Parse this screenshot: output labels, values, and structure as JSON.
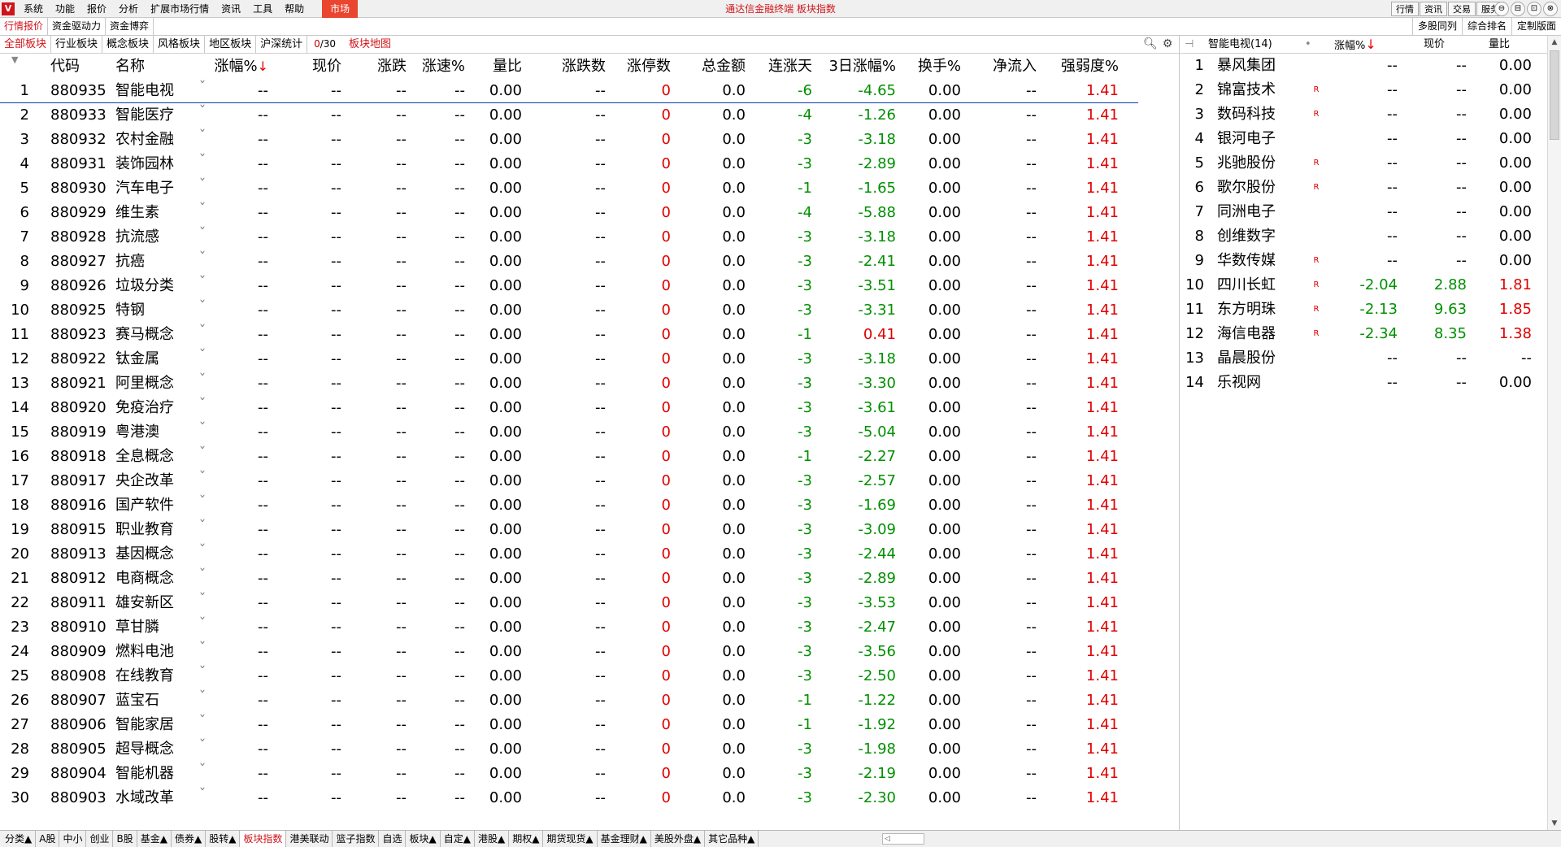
{
  "app": {
    "logo_glyph": "V",
    "title": "通达信金融终端  板块指数",
    "menu": [
      "系统",
      "功能",
      "报价",
      "分析",
      "扩展市场行情",
      "资讯",
      "工具",
      "帮助"
    ],
    "market_button": "市场",
    "right_buttons": [
      "行情",
      "资讯",
      "交易",
      "服务"
    ],
    "window_controls": [
      "⊖",
      "⊟",
      "⊡",
      "⊗"
    ]
  },
  "row2": {
    "tabs": [
      "行情报价",
      "资金驱动力",
      "资金博弈"
    ],
    "right_tabs": [
      "多股同列",
      "综合排名",
      "定制版面"
    ]
  },
  "categories": {
    "tabs": [
      "全部板块",
      "行业板块",
      "概念板块",
      "风格板块",
      "地区板块",
      "沪深统计"
    ],
    "active": 0,
    "counter_current": "0",
    "counter_total": "/30",
    "map_link": "板块地图",
    "icons": [
      "search-icon",
      "gear-icon"
    ]
  },
  "table": {
    "sort_indicator": "▼",
    "headers": {
      "code": "代码",
      "name": "名称",
      "chg": "涨幅%",
      "price": "现价",
      "updn": "涨跌",
      "speed": "涨速%",
      "vr": "量比",
      "count": "涨跌数",
      "lim": "涨停数",
      "amt": "总金额",
      "cont": "连涨天",
      "d3": "3日涨幅%",
      "turn": "换手%",
      "flow": "净流入",
      "str": "强弱度%"
    },
    "sort_arrow": "↓",
    "rows": [
      {
        "idx": "1",
        "code": "880935",
        "name": "智能电视",
        "cont": "-6",
        "d3": "-4.65"
      },
      {
        "idx": "2",
        "code": "880933",
        "name": "智能医疗",
        "cont": "-4",
        "d3": "-1.26"
      },
      {
        "idx": "3",
        "code": "880932",
        "name": "农村金融",
        "cont": "-3",
        "d3": "-3.18"
      },
      {
        "idx": "4",
        "code": "880931",
        "name": "装饰园林",
        "cont": "-3",
        "d3": "-2.89"
      },
      {
        "idx": "5",
        "code": "880930",
        "name": "汽车电子",
        "cont": "-1",
        "d3": "-1.65"
      },
      {
        "idx": "6",
        "code": "880929",
        "name": "维生素",
        "cont": "-4",
        "d3": "-5.88"
      },
      {
        "idx": "7",
        "code": "880928",
        "name": "抗流感",
        "cont": "-3",
        "d3": "-3.18"
      },
      {
        "idx": "8",
        "code": "880927",
        "name": "抗癌",
        "cont": "-3",
        "d3": "-2.41"
      },
      {
        "idx": "9",
        "code": "880926",
        "name": "垃圾分类",
        "cont": "-3",
        "d3": "-3.51"
      },
      {
        "idx": "10",
        "code": "880925",
        "name": "特钢",
        "cont": "-3",
        "d3": "-3.31"
      },
      {
        "idx": "11",
        "code": "880923",
        "name": "赛马概念",
        "cont": "-1",
        "d3": "0.41"
      },
      {
        "idx": "12",
        "code": "880922",
        "name": "钛金属",
        "cont": "-3",
        "d3": "-3.18"
      },
      {
        "idx": "13",
        "code": "880921",
        "name": "阿里概念",
        "cont": "-3",
        "d3": "-3.30"
      },
      {
        "idx": "14",
        "code": "880920",
        "name": "免疫治疗",
        "cont": "-3",
        "d3": "-3.61"
      },
      {
        "idx": "15",
        "code": "880919",
        "name": "粤港澳",
        "cont": "-3",
        "d3": "-5.04"
      },
      {
        "idx": "16",
        "code": "880918",
        "name": "全息概念",
        "cont": "-1",
        "d3": "-2.27"
      },
      {
        "idx": "17",
        "code": "880917",
        "name": "央企改革",
        "cont": "-3",
        "d3": "-2.57"
      },
      {
        "idx": "18",
        "code": "880916",
        "name": "国产软件",
        "cont": "-3",
        "d3": "-1.69"
      },
      {
        "idx": "19",
        "code": "880915",
        "name": "职业教育",
        "cont": "-3",
        "d3": "-3.09"
      },
      {
        "idx": "20",
        "code": "880913",
        "name": "基因概念",
        "cont": "-3",
        "d3": "-2.44"
      },
      {
        "idx": "21",
        "code": "880912",
        "name": "电商概念",
        "cont": "-3",
        "d3": "-2.89"
      },
      {
        "idx": "22",
        "code": "880911",
        "name": "雄安新区",
        "cont": "-3",
        "d3": "-3.53"
      },
      {
        "idx": "23",
        "code": "880910",
        "name": "草甘膦",
        "cont": "-3",
        "d3": "-2.47"
      },
      {
        "idx": "24",
        "code": "880909",
        "name": "燃料电池",
        "cont": "-3",
        "d3": "-3.56"
      },
      {
        "idx": "25",
        "code": "880908",
        "name": "在线教育",
        "cont": "-3",
        "d3": "-2.50"
      },
      {
        "idx": "26",
        "code": "880907",
        "name": "蓝宝石",
        "cont": "-1",
        "d3": "-1.22"
      },
      {
        "idx": "27",
        "code": "880906",
        "name": "智能家居",
        "cont": "-1",
        "d3": "-1.92"
      },
      {
        "idx": "28",
        "code": "880905",
        "name": "超导概念",
        "cont": "-3",
        "d3": "-1.98"
      },
      {
        "idx": "29",
        "code": "880904",
        "name": "智能机器",
        "cont": "-3",
        "d3": "-2.19"
      },
      {
        "idx": "30",
        "code": "880903",
        "name": "水域改革",
        "cont": "-3",
        "d3": "-2.30"
      }
    ],
    "common": {
      "mark": "ˇ",
      "chg": "--",
      "price": "--",
      "updn": "--",
      "speed": "--",
      "vr": "0.00",
      "count": "--",
      "lim": "0",
      "amt": "0.0",
      "turn": "0.00",
      "flow": "--",
      "str": "1.41"
    }
  },
  "right_panel": {
    "pin_glyph": "⊣",
    "title": "智能电视(14)",
    "dot": "•",
    "headers": {
      "chg": "涨幅%",
      "price": "现价",
      "vr": "量比"
    },
    "sort_arrow": "↓",
    "rows": [
      {
        "idx": "1",
        "name": "暴风集团",
        "flag": "",
        "chg": "--",
        "price": "--",
        "vr": "0.00"
      },
      {
        "idx": "2",
        "name": "锦富技术",
        "flag": "R",
        "chg": "--",
        "price": "--",
        "vr": "0.00"
      },
      {
        "idx": "3",
        "name": "数码科技",
        "flag": "R",
        "chg": "--",
        "price": "--",
        "vr": "0.00"
      },
      {
        "idx": "4",
        "name": "银河电子",
        "flag": "",
        "chg": "--",
        "price": "--",
        "vr": "0.00"
      },
      {
        "idx": "5",
        "name": "兆驰股份",
        "flag": "R",
        "chg": "--",
        "price": "--",
        "vr": "0.00"
      },
      {
        "idx": "6",
        "name": "歌尔股份",
        "flag": "R",
        "chg": "--",
        "price": "--",
        "vr": "0.00"
      },
      {
        "idx": "7",
        "name": "同洲电子",
        "flag": "",
        "chg": "--",
        "price": "--",
        "vr": "0.00"
      },
      {
        "idx": "8",
        "name": "创维数字",
        "flag": "",
        "chg": "--",
        "price": "--",
        "vr": "0.00"
      },
      {
        "idx": "9",
        "name": "华数传媒",
        "flag": "R",
        "chg": "--",
        "price": "--",
        "vr": "0.00"
      },
      {
        "idx": "10",
        "name": "四川长虹",
        "flag": "R",
        "chg": "-2.04",
        "price": "2.88",
        "vr": "1.81"
      },
      {
        "idx": "11",
        "name": "东方明珠",
        "flag": "R",
        "chg": "-2.13",
        "price": "9.63",
        "vr": "1.85"
      },
      {
        "idx": "12",
        "name": "海信电器",
        "flag": "R",
        "chg": "-2.34",
        "price": "8.35",
        "vr": "1.38"
      },
      {
        "idx": "13",
        "name": "晶晨股份",
        "flag": "",
        "chg": "--",
        "price": "--",
        "vr": "--"
      },
      {
        "idx": "14",
        "name": "乐视网",
        "flag": "",
        "chg": "--",
        "price": "--",
        "vr": "0.00"
      }
    ]
  },
  "bottom_tabs": {
    "items": [
      "分类▲",
      "A股",
      "中小",
      "创业",
      "B股",
      "基金▲",
      "债券▲",
      "股转▲",
      "板块指数",
      "港美联动",
      "篮子指数",
      "自选",
      "板块▲",
      "自定▲",
      "港股▲",
      "期权▲",
      "期货现货▲",
      "基金理财▲",
      "美股外盘▲",
      "其它品种▲"
    ],
    "active": 8,
    "scroll_glyph": "◁"
  },
  "colors": {
    "up": "#e00000",
    "down": "#009000",
    "accent": "#d0141a",
    "selection_line": "#0a3fae"
  }
}
